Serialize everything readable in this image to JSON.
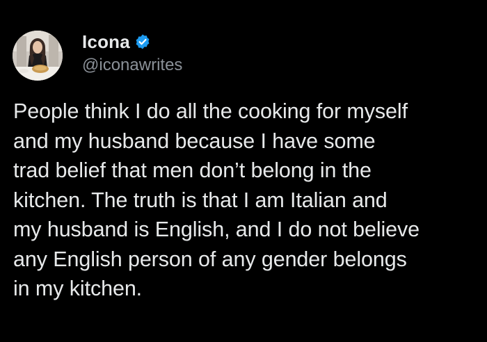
{
  "theme": {
    "background": "#000000",
    "text_color": "#e7e9ea",
    "secondary_text_color": "#8b9198",
    "verified_color": "#1d9bf0"
  },
  "author": {
    "display_name": "Icona",
    "handle": "@iconawrites",
    "verified": true,
    "avatar_icon": "profile-photo"
  },
  "tweet": {
    "text": "People think I do all the cooking for myself\nand my husband because I have some\ntrad belief that men don’t belong in the\nkitchen. The truth is that I am Italian and\nmy husband is English, and I do not believe\nany English person of any gender belongs\nin my kitchen."
  }
}
